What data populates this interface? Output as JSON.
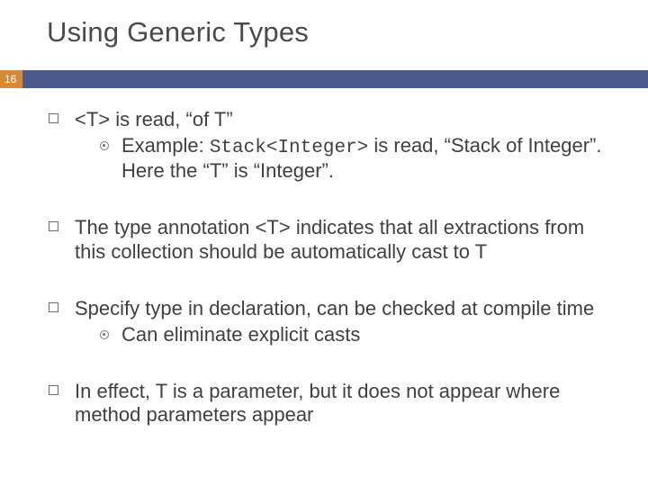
{
  "title": "Using Generic Types",
  "pageNumber": "16",
  "bullets": {
    "b0": {
      "line1_pre": "<T> is read, “of T”",
      "sub": {
        "pre": "Example: ",
        "code": "Stack<Integer>",
        "post": " is read, “Stack of Integer”.  Here the “T” is “Integer”."
      }
    },
    "b1": "The type annotation <T> indicates that all extractions from this collection should be automatically cast to T",
    "b2": {
      "text": "Specify type in declaration, can be checked at compile time",
      "sub": "Can eliminate explicit casts"
    },
    "b3": "In effect, T is a parameter, but it does not appear where method parameters appear"
  }
}
